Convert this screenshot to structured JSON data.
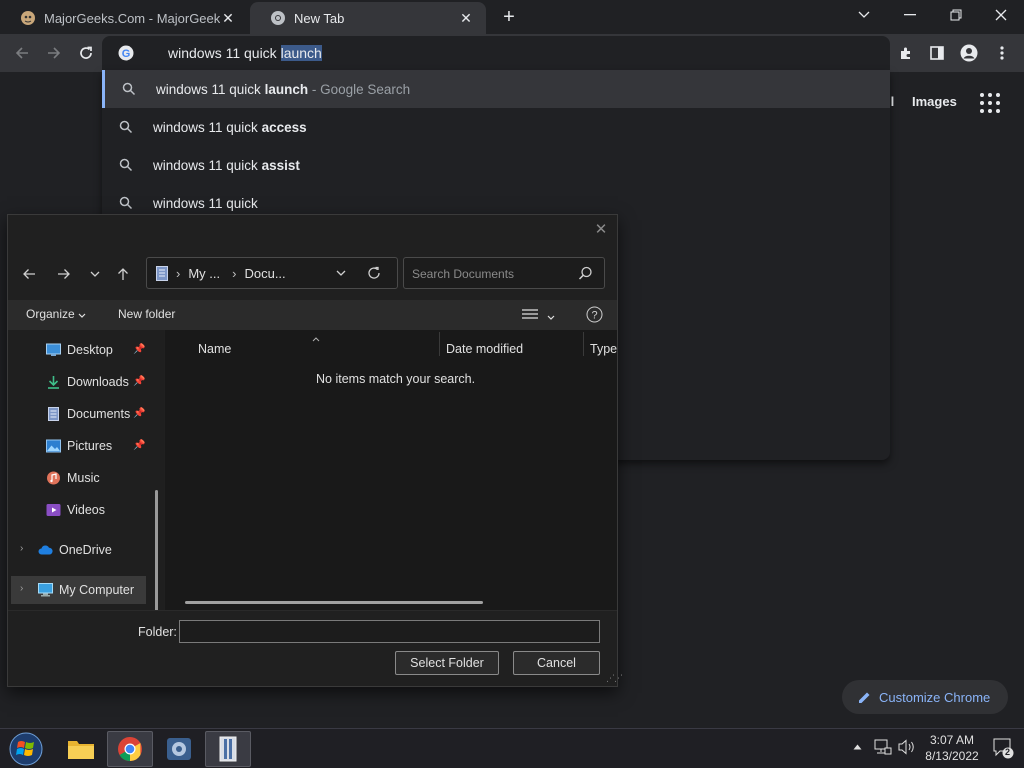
{
  "browser": {
    "tabs": [
      {
        "title": "MajorGeeks.Com - MajorGeeks",
        "active": false
      },
      {
        "title": "New Tab",
        "active": true
      }
    ],
    "new_tab_label": "+",
    "window_controls": {
      "dropdown": "˅",
      "minimize": "—",
      "restore": "❐",
      "close": "✕"
    },
    "omnibox": {
      "prefix": "windows 11 quick ",
      "selected": "launch"
    },
    "suggestions": [
      {
        "plain": "windows 11 quick ",
        "bold": "launch",
        "suffix": " - Google Search",
        "highlighted": true
      },
      {
        "plain": "windows 11 quick ",
        "bold": "access",
        "suffix": "",
        "highlighted": false
      },
      {
        "plain": "windows 11 quick ",
        "bold": "assist",
        "suffix": "",
        "highlighted": false
      },
      {
        "plain": "windows 11 quick",
        "bold": "",
        "suffix": "",
        "highlighted": false
      }
    ],
    "ntp": {
      "gmail_partial": "il",
      "images": "Images",
      "customize_label": "Customize Chrome"
    }
  },
  "dialog": {
    "close": "✕",
    "breadcrumb": [
      "My ...",
      "Docu..."
    ],
    "search_placeholder": "Search Documents",
    "commands": {
      "organize": "Organize",
      "new_folder": "New folder"
    },
    "nav_items": [
      {
        "label": "Desktop",
        "icon": "desktop-icon",
        "pinned": true
      },
      {
        "label": "Downloads",
        "icon": "download-icon",
        "pinned": true
      },
      {
        "label": "Documents",
        "icon": "documents-icon",
        "pinned": true
      },
      {
        "label": "Pictures",
        "icon": "pictures-icon",
        "pinned": true
      },
      {
        "label": "Music",
        "icon": "music-icon",
        "pinned": false
      },
      {
        "label": "Videos",
        "icon": "videos-icon",
        "pinned": false
      },
      {
        "label": "OneDrive",
        "icon": "cloud-icon",
        "pinned": false
      },
      {
        "label": "My Computer",
        "icon": "computer-icon",
        "pinned": false
      }
    ],
    "columns": [
      "Name",
      "Date modified",
      "Type"
    ],
    "empty_message": "No items match your search.",
    "folder_label": "Folder:",
    "folder_value": "",
    "select_folder": "Select Folder",
    "cancel": "Cancel"
  },
  "taskbar": {
    "apps": [
      "file-explorer-icon",
      "chrome-icon",
      "settings-icon",
      "archive-icon"
    ],
    "time": "3:07 AM",
    "date": "8/13/2022",
    "notification_count": "2"
  },
  "colors": {
    "chrome_bg": "#202124",
    "toolbar": "#35363a",
    "accent_blue": "#8ab4f8",
    "dialog_bg": "#202020"
  }
}
